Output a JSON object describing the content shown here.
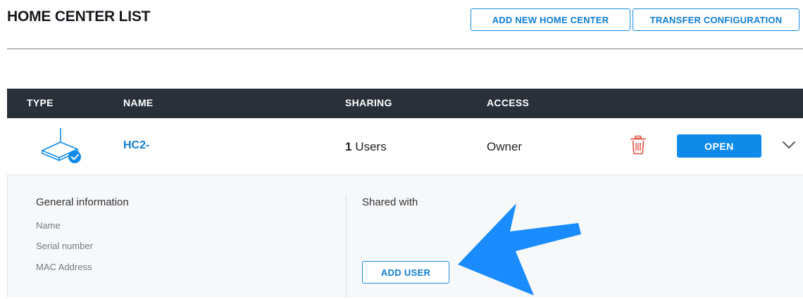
{
  "header": {
    "title": "HOME CENTER LIST",
    "add_button": "ADD NEW HOME CENTER",
    "transfer_button": "TRANSFER CONFIGURATION"
  },
  "table": {
    "columns": {
      "type": "TYPE",
      "name": "NAME",
      "sharing": "SHARING",
      "access": "ACCESS"
    },
    "row": {
      "type_icon": "router-verified-icon",
      "name": "HC2-",
      "users_count": "1",
      "users_label": " Users",
      "access": "Owner",
      "delete_icon": "trash-icon",
      "open_label": "OPEN",
      "expand_icon": "chevron-down-icon"
    }
  },
  "details": {
    "general_title": "General information",
    "name_label": "Name",
    "serial_label": "Serial number",
    "mac_label": "MAC Address",
    "shared_title": "Shared with",
    "add_user_label": "ADD USER"
  },
  "colors": {
    "accent": "#0f8ae8",
    "header_bg": "#2a303a",
    "danger": "#e0503c",
    "annotation_arrow": "#1a8cff"
  }
}
